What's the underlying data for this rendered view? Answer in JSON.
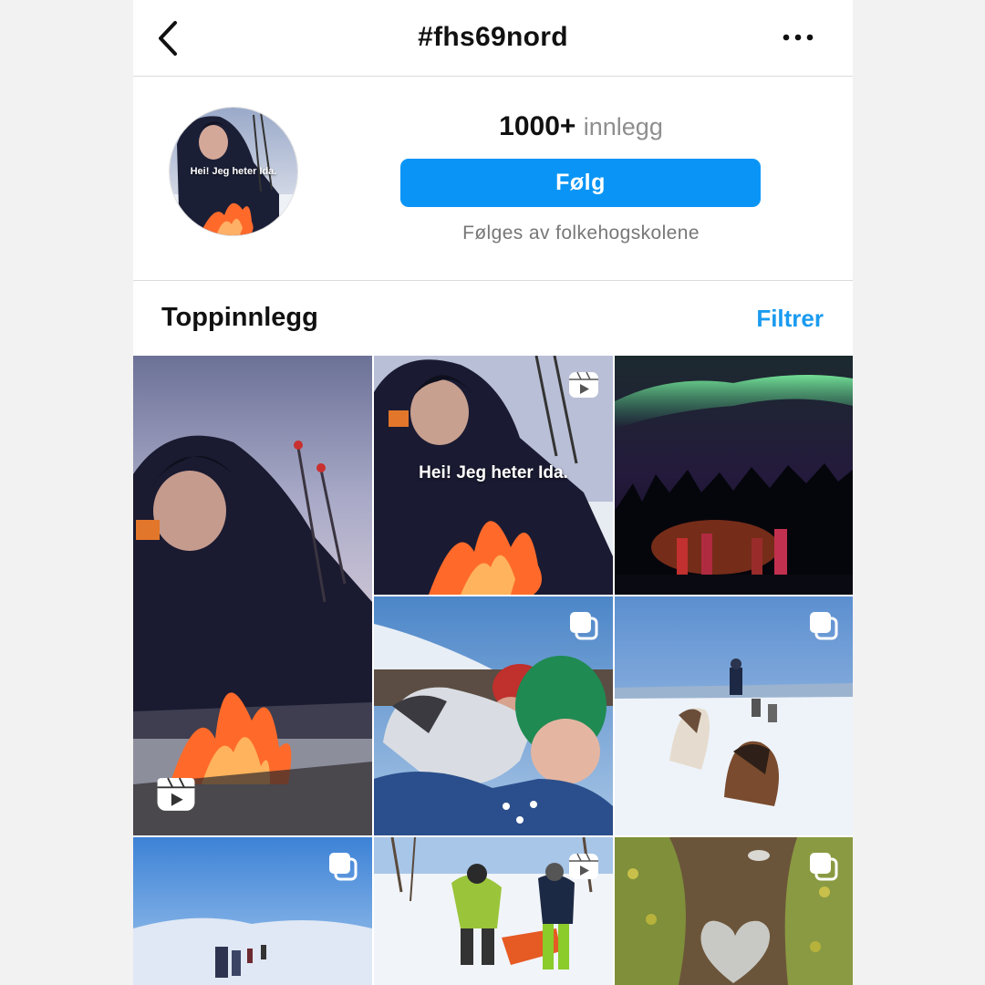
{
  "header": {
    "title": "#fhs69nord",
    "back_icon": "chevron-left-icon",
    "more_icon": "more-horizontal-icon"
  },
  "profile": {
    "avatar_caption": "Hei! Jeg heter Ida.",
    "post_count": "1000+",
    "post_label": "innlegg",
    "follow_label": "Følg",
    "followed_by": "Følges av folkehogskolene",
    "accent_color": "#0a95f6"
  },
  "section": {
    "title": "Toppinnlegg",
    "filter_label": "Filtrer",
    "filter_color": "#1a9bf0"
  },
  "posts": [
    {
      "subject": "campfire-selfie",
      "badge": "reels-icon"
    },
    {
      "subject": "campfire-selfie-caption",
      "badge": "reels-icon",
      "caption": "Hei! Jeg heter Ida."
    },
    {
      "subject": "northern-lights",
      "badge": ""
    },
    {
      "subject": "dog-kiss",
      "badge": "carousel-icon"
    },
    {
      "subject": "dog-sledding",
      "badge": "carousel-icon"
    },
    {
      "subject": "ski-expedition",
      "badge": "carousel-icon"
    },
    {
      "subject": "sled-hauling",
      "badge": "reels-icon"
    },
    {
      "subject": "heart-rock",
      "badge": "carousel-icon"
    }
  ]
}
